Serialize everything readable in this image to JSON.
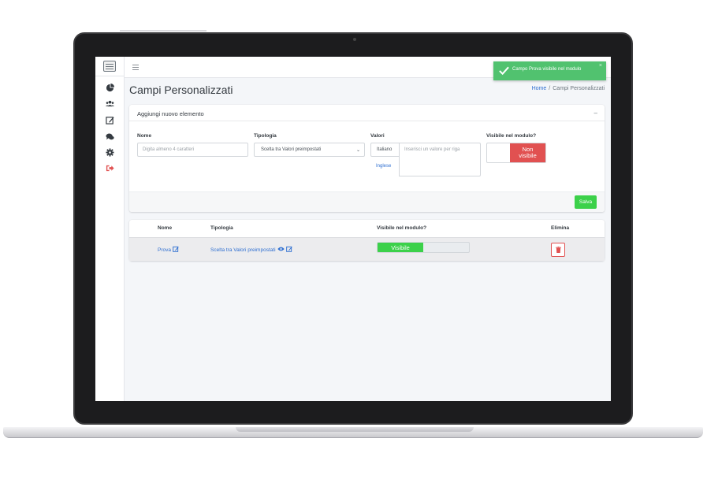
{
  "colors": {
    "accent_green": "#3cd14a",
    "toast_green": "#51c26f",
    "danger_red": "#e15151",
    "link_blue": "#2f6fd1"
  },
  "sidebar": {
    "icons": [
      "logo-icon",
      "chart-pie-icon",
      "users-icon",
      "edit-icon",
      "comments-icon",
      "gear-icon",
      "sign-out-icon"
    ]
  },
  "toast": {
    "message": "Campo Prova visibile nel modulo",
    "close": "×"
  },
  "page": {
    "title": "Campi Personalizzati",
    "breadcrumb_home": "Home",
    "breadcrumb_sep": "/",
    "breadcrumb_current": "Campi Personalizzati"
  },
  "form": {
    "title": "Aggiungi nuovo elemento",
    "collapse_symbol": "–",
    "nome_label": "Nome",
    "nome_placeholder": "Digita almeno 4 caratteri",
    "tipologia_label": "Tipologia",
    "tipologia_value": "Scelta tra Valori preimpostati",
    "valori_label": "Valori",
    "lang_it": "Italiano",
    "lang_en": "Inglese",
    "valori_placeholder": "Inserisci un valore per riga",
    "visibile_label": "Visibile nel modulo?",
    "toggle_off_line1": "Non",
    "toggle_off_line2": "visibile",
    "save_label": "Salva"
  },
  "table": {
    "headers": {
      "nome": "Nome",
      "tipologia": "Tipologia",
      "visibile": "Visibile nel modulo?",
      "elimina": "Elimina"
    },
    "rows": [
      {
        "nome": "Prova",
        "tipologia": "Scelta tra Valori preimpostati",
        "visibile_label": "Visibile",
        "visibile_fraction": 0.5
      }
    ]
  }
}
